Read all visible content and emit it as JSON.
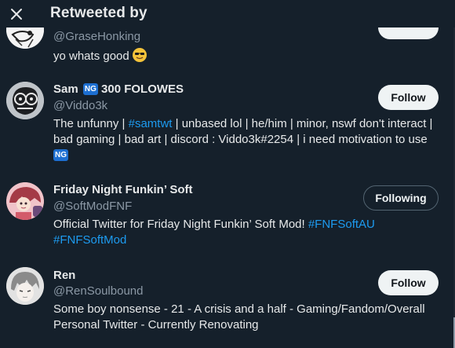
{
  "header": {
    "title": "Retweeted by",
    "close_icon": "close-icon"
  },
  "colors": {
    "background": "#15202b",
    "link": "#1d9bf0",
    "muted": "#8b98a5",
    "badge": "#1d6fd1"
  },
  "users": [
    {
      "handle": "@GraseHonking",
      "bio": "yo whats good",
      "bio_emoji": "smiling-face-with-sunglasses"
    },
    {
      "name": "Sam",
      "name_badge": "NG",
      "name_suffix": "300 FOLOWES",
      "handle": "@Viddo3k",
      "bio_pre": "The unfunny | ",
      "bio_link": "#samtwt",
      "bio_post": " | unbased lol | he/him | minor, nswf don't interact | bad gaming | bad art | discord : Viddo3k#2254 | i need motivation to use",
      "bio_badge": "NG",
      "button": "Follow"
    },
    {
      "name": "Friday Night Funkin’ Soft",
      "handle": "@SoftModFNF",
      "bio_pre": "Official Twitter for Friday Night Funkin’ Soft Mod! ",
      "bio_link1": "#FNFSoftAU",
      "bio_link2": "#FNFSoftMod",
      "button": "Following"
    },
    {
      "name": "Ren",
      "handle": "@RenSoulbound",
      "bio": "Some boy nonsense - 21 - A crisis and a half - Gaming/Fandom/Overall Personal Twitter - Currently Renovating",
      "button": "Follow"
    }
  ]
}
